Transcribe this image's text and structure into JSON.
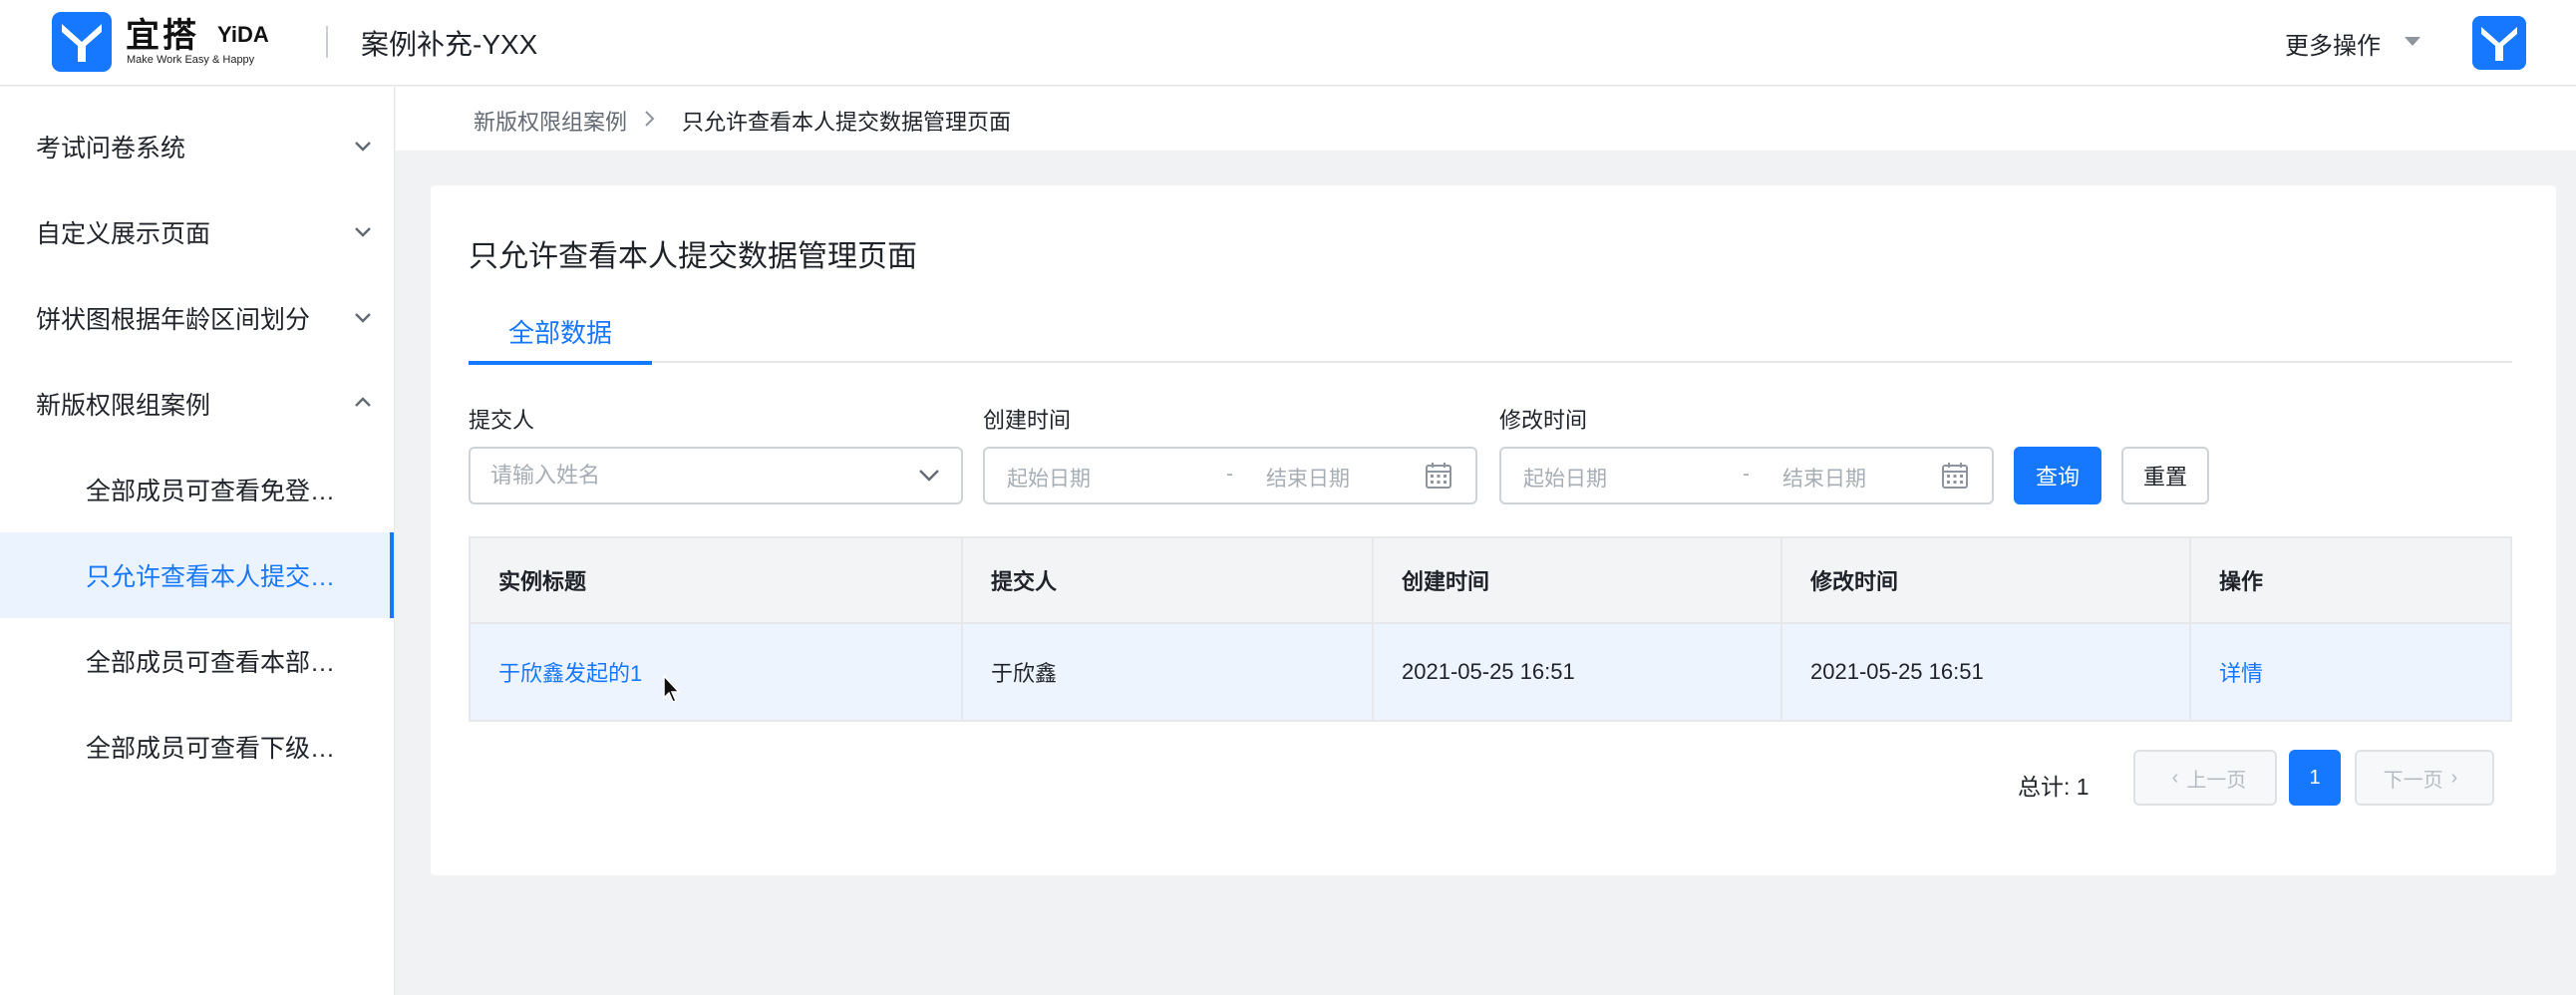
{
  "header": {
    "logo_cn": "宜搭",
    "logo_en": "YiDA",
    "logo_tagline": "Make Work Easy & Happy",
    "app_title": "案例补充-YXX",
    "more_actions": "更多操作",
    "brand_color": "#1677ff"
  },
  "sidebar": {
    "items": [
      {
        "label": "考试问卷系统",
        "type": "group",
        "expanded": false,
        "icon": "chevron-down-icon"
      },
      {
        "label": "自定义展示页面",
        "type": "group",
        "expanded": false,
        "icon": "chevron-down-icon"
      },
      {
        "label": "饼状图根据年龄区间划分",
        "type": "group",
        "expanded": false,
        "icon": "chevron-down-icon"
      },
      {
        "label": "新版权限组案例",
        "type": "group",
        "expanded": true,
        "icon": "chevron-up-icon"
      },
      {
        "label": "全部成员可查看免登…",
        "type": "child",
        "active": false
      },
      {
        "label": "只允许查看本人提交…",
        "type": "child",
        "active": true
      },
      {
        "label": "全部成员可查看本部…",
        "type": "child",
        "active": false
      },
      {
        "label": "全部成员可查看下级…",
        "type": "child",
        "active": false
      }
    ]
  },
  "breadcrumb": {
    "items": [
      "新版权限组案例",
      "只允许查看本人提交数据管理页面"
    ]
  },
  "main": {
    "page_title": "只允许查看本人提交数据管理页面",
    "tabs": [
      {
        "label": "全部数据",
        "active": true
      }
    ],
    "filters": {
      "submitter_label": "提交人",
      "submitter_placeholder": "请输入姓名",
      "created_label": "创建时间",
      "modified_label": "修改时间",
      "start_placeholder": "起始日期",
      "range_separator": "-",
      "end_placeholder": "结束日期",
      "query_button": "查询",
      "reset_button": "重置"
    },
    "table": {
      "columns": [
        "实例标题",
        "提交人",
        "创建时间",
        "修改时间",
        "操作"
      ],
      "rows": [
        {
          "title": "于欣鑫发起的1",
          "submitter": "于欣鑫",
          "created": "2021-05-25 16:51",
          "modified": "2021-05-25 16:51",
          "action": "详情"
        }
      ]
    },
    "pagination": {
      "total": "总计: 1",
      "prev": "上一页",
      "next": "下一页",
      "current_page": "1"
    }
  }
}
